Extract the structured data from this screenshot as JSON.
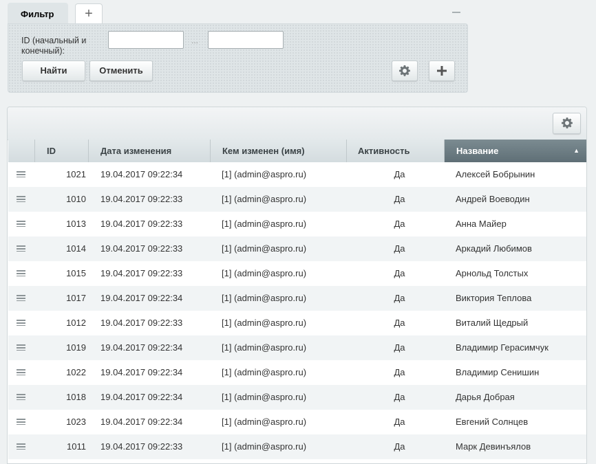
{
  "filter": {
    "tab_label": "Фильтр",
    "add_tab_symbol": "+",
    "id_label": "ID (начальный и конечный):",
    "range_separator": "...",
    "id_from_value": "",
    "id_to_value": "",
    "find_label": "Найти",
    "cancel_label": "Отменить",
    "settings_icon": "gear-icon",
    "add_icon": "plus-icon"
  },
  "grid": {
    "settings_icon": "gear-icon",
    "columns": {
      "id": "ID",
      "date": "Дата изменения",
      "user": "Кем изменен (имя)",
      "active": "Активность",
      "name": "Название"
    },
    "sorted_column": "Название",
    "sort_direction": "asc",
    "rows": [
      {
        "id": "1021",
        "date": "19.04.2017 09:22:34",
        "user": "[1] (admin@aspro.ru)",
        "active": "Да",
        "name": "Алексей Бобрынин"
      },
      {
        "id": "1010",
        "date": "19.04.2017 09:22:33",
        "user": "[1] (admin@aspro.ru)",
        "active": "Да",
        "name": "Андрей Воеводин"
      },
      {
        "id": "1013",
        "date": "19.04.2017 09:22:33",
        "user": "[1] (admin@aspro.ru)",
        "active": "Да",
        "name": "Анна Майер"
      },
      {
        "id": "1014",
        "date": "19.04.2017 09:22:33",
        "user": "[1] (admin@aspro.ru)",
        "active": "Да",
        "name": "Аркадий Любимов"
      },
      {
        "id": "1015",
        "date": "19.04.2017 09:22:33",
        "user": "[1] (admin@aspro.ru)",
        "active": "Да",
        "name": "Арнольд Толстых"
      },
      {
        "id": "1017",
        "date": "19.04.2017 09:22:34",
        "user": "[1] (admin@aspro.ru)",
        "active": "Да",
        "name": "Виктория Теплова"
      },
      {
        "id": "1012",
        "date": "19.04.2017 09:22:33",
        "user": "[1] (admin@aspro.ru)",
        "active": "Да",
        "name": "Виталий Щедрый"
      },
      {
        "id": "1019",
        "date": "19.04.2017 09:22:34",
        "user": "[1] (admin@aspro.ru)",
        "active": "Да",
        "name": "Владимир Герасимчук"
      },
      {
        "id": "1022",
        "date": "19.04.2017 09:22:34",
        "user": "[1] (admin@aspro.ru)",
        "active": "Да",
        "name": "Владимир Сенишин"
      },
      {
        "id": "1018",
        "date": "19.04.2017 09:22:34",
        "user": "[1] (admin@aspro.ru)",
        "active": "Да",
        "name": "Дарья Добрая"
      },
      {
        "id": "1023",
        "date": "19.04.2017 09:22:34",
        "user": "[1] (admin@aspro.ru)",
        "active": "Да",
        "name": "Евгений Солнцев"
      },
      {
        "id": "1011",
        "date": "19.04.2017 09:22:33",
        "user": "[1] (admin@aspro.ru)",
        "active": "Да",
        "name": "Марк Девинъялов"
      }
    ]
  }
}
